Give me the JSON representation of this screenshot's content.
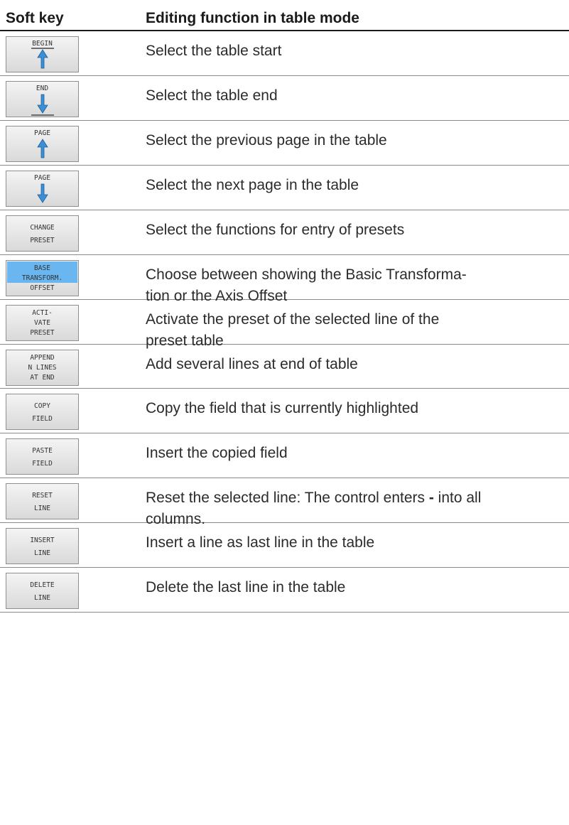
{
  "table": {
    "header": {
      "softkey": "Soft key",
      "function": "Editing function in table mode"
    },
    "rows": [
      {
        "key_lines": [
          "BEGIN"
        ],
        "icon": "arrow-up-to-line-icon",
        "description": "Select the table start"
      },
      {
        "key_lines": [
          "END"
        ],
        "icon": "arrow-down-to-line-icon",
        "description": "Select the table end"
      },
      {
        "key_lines": [
          "PAGE"
        ],
        "icon": "arrow-up-icon",
        "description": "Select the previous page in the table"
      },
      {
        "key_lines": [
          "PAGE"
        ],
        "icon": "arrow-down-icon",
        "description": "Select the next page in the table"
      },
      {
        "key_lines": [
          "CHANGE",
          "PRESET"
        ],
        "description": "Select the functions for entry of presets"
      },
      {
        "key_lines": [
          "BASE",
          "TRANSFORM.",
          "OFFSET"
        ],
        "highlight_lines": 2,
        "highlight_color": "#6ab6f0",
        "description": "Choose between showing the Basic Transforma-\ntion or the Axis Offset"
      },
      {
        "key_lines": [
          "ACTI-",
          "VATE",
          "PRESET"
        ],
        "description": "Activate the preset of the selected line of the\npreset table"
      },
      {
        "key_lines": [
          "APPEND",
          "N LINES",
          "AT END"
        ],
        "description": "Add several lines at end of table"
      },
      {
        "key_lines": [
          "COPY",
          "FIELD"
        ],
        "description": "Copy the field that is currently highlighted"
      },
      {
        "key_lines": [
          "PASTE",
          "FIELD"
        ],
        "description": "Insert the copied field"
      },
      {
        "key_lines": [
          "RESET",
          "LINE"
        ],
        "description_parts": [
          "Reset the selected line: The control enters ",
          "-",
          " into all\ncolumns."
        ]
      },
      {
        "key_lines": [
          "INSERT",
          "LINE"
        ],
        "description": "Insert a line as last line in the table"
      },
      {
        "key_lines": [
          "DELETE",
          "LINE"
        ],
        "description": "Delete the last line in the table"
      }
    ]
  }
}
